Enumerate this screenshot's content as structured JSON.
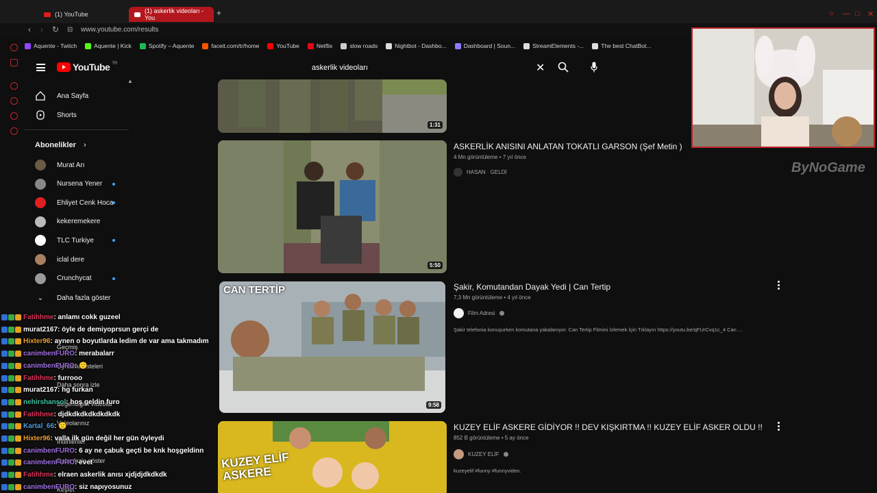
{
  "browser": {
    "tabs": [
      {
        "label": "(1) YouTube",
        "active": false
      },
      {
        "label": "(1) askerlik videoları - You",
        "active": true
      }
    ],
    "url": "www.youtube.com/results",
    "bookmarks": [
      {
        "label": "Aquente - Twitch",
        "color": "#9146ff"
      },
      {
        "label": "Aquente | Kick",
        "color": "#53fc18"
      },
      {
        "label": "Spotify – Aquente",
        "color": "#1db954"
      },
      {
        "label": "faceit.com/tr/home",
        "color": "#ff5500"
      },
      {
        "label": "YouTube",
        "color": "#ff0000"
      },
      {
        "label": "Netflix",
        "color": "#e50914"
      },
      {
        "label": "slow roads",
        "color": "#cccccc"
      },
      {
        "label": "Nightbot - Dashbo...",
        "color": "#dddddd"
      },
      {
        "label": "Dashboard | Soun...",
        "color": "#8a7cff"
      },
      {
        "label": "StreamElements -...",
        "color": "#dddddd"
      },
      {
        "label": "The best ChatBot...",
        "color": "#dddddd"
      }
    ]
  },
  "header": {
    "logo_text": "YouTube",
    "country": "TR",
    "search_value": "askerlik videoları"
  },
  "sidebar": {
    "main": [
      {
        "label": "Ana Sayfa",
        "icon": "home-icon"
      },
      {
        "label": "Shorts",
        "icon": "shorts-icon"
      }
    ],
    "subscriptions_title": "Abonelikler",
    "subscriptions": [
      {
        "label": "Murat Arı",
        "color": "#6b5a44",
        "dot": false
      },
      {
        "label": "Nursena Yener",
        "color": "#888888",
        "dot": true
      },
      {
        "label": "Ehliyet Cenk Hoca",
        "color": "#e02020",
        "dot": true
      },
      {
        "label": "kekeremekere",
        "color": "#bbbbbb",
        "dot": false
      },
      {
        "label": "TLC Turkiye",
        "color": "#ffffff",
        "dot": true
      },
      {
        "label": "iclal dere",
        "color": "#a88060",
        "dot": false
      },
      {
        "label": "Crunchycat",
        "color": "#9a9a9a",
        "dot": true
      }
    ],
    "show_more": "Daha fazla göster",
    "ghost_items": [
      "Geçmiş",
      "Oynatma listeleri",
      "Daha sonra izle",
      "Beğendiğim videolar",
      "Videolarınız",
      "İndirilenler",
      "Daha fazla göster",
      "Keşfet"
    ]
  },
  "results": [
    {
      "title": "",
      "duration": "1:31"
    },
    {
      "title": "ASKERLİK ANISINI ANLATAN TOKATLI GARSON (Şef Metin )",
      "meta": "4 Mn görüntüleme • 7 yıl önce",
      "channel": "HASAN · GELDİ",
      "duration": "5:50",
      "description": ""
    },
    {
      "title": "Şakir, Komutandan Dayak Yedi | Can Tertip",
      "meta": "7,3 Mn görüntüleme • 4 yıl önce",
      "channel": "Film Adresi",
      "duration": "9:58",
      "thumb_text": "CAN TERTİP",
      "description": "Şakir telefonia konuşurken komutana yakalanıyor. Can Tertip Filmini İzlemek İçin Tıklayın https://youtu.be/qFUrCvq1c_4 Can ..."
    },
    {
      "title": "KUZEY ELİF ASKERE GİDİYOR !! DEV KIŞKIRTMA !! KUZEY ELİF ASKER OLDU !!",
      "meta": "852 B görüntüleme • 5 ay önce",
      "channel": "KUZEY ELİF",
      "thumb_text": "KUZEY ELİF ASKERE",
      "description": "kuzeyelif #funny #funnyvideo."
    }
  ],
  "overlay": {
    "watermark": "ByNoGame"
  },
  "chat": [
    {
      "user": "Fatihhme",
      "color": "#d8365a",
      "text": ": anlamı cokk guzeel"
    },
    {
      "user": "murat2167",
      "color": "#ffffff",
      "text": ": öyle de demiyoprsun gerçi de"
    },
    {
      "user": "Hixter96",
      "color": "#f0a030",
      "text": ": aynen o boyutlarda ledim de var ama takmadım"
    },
    {
      "user": "canimbenFURO",
      "color": "#a070e0",
      "text": ": merabalarr"
    },
    {
      "user": "canimbenFURO",
      "color": "#a070e0",
      "text": ": 🙂"
    },
    {
      "user": "Fatihhme",
      "color": "#d8365a",
      "text": ": furrooo"
    },
    {
      "user": "murat2167",
      "color": "#ffffff",
      "text": ": hg furkan"
    },
    {
      "user": "nehirshansol",
      "color": "#40c0a0",
      "text": ": hoş geldin furo"
    },
    {
      "user": "Fatihhme",
      "color": "#d8365a",
      "text": ": djdkdkdkdkdkdkdk"
    },
    {
      "user": "Kartal_66",
      "color": "#4aa0e0",
      "text": ": 🙂"
    },
    {
      "user": "Hixter96",
      "color": "#f0a030",
      "text": ": valla ilk gün değil her gün öyleydi"
    },
    {
      "user": "canimbenFURO",
      "color": "#a070e0",
      "text": ": 6 ay ne çabuk geçti be knk hoşgeldinn"
    },
    {
      "user": "canimbenFURO",
      "color": "#a070e0",
      "text": ": evet"
    },
    {
      "user": "Fatihhme",
      "color": "#d8365a",
      "text": ": elraen askerlik anısı xjdjdjdkdkdk"
    },
    {
      "user": "canimbenFURO",
      "color": "#a070e0",
      "text": ": siz napıyosunuz"
    }
  ]
}
